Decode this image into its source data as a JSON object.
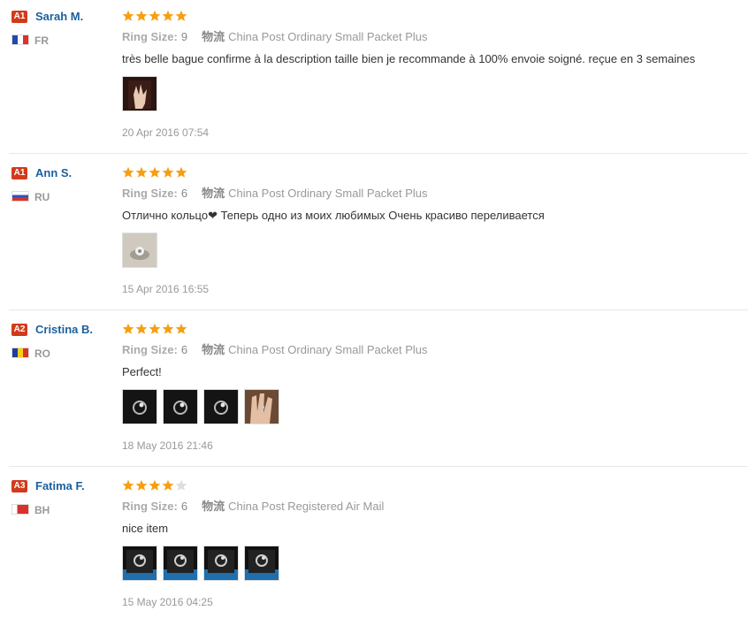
{
  "reviews": [
    {
      "badge": "A1",
      "name": "Sarah M.",
      "country": "FR",
      "flag": [
        "#1f4aa8",
        "#ffffff",
        "#e0302c"
      ],
      "rating": 5,
      "ring_size_label": "Ring Size:",
      "ring_size": "9",
      "shipping_label": "物流",
      "shipping": "China Post Ordinary Small Packet Plus",
      "text": "très belle bague confirme à la description taille bien je recommande à 100% envoie soigné. reçue en 3 semaines",
      "photos": [
        "photo-hand"
      ],
      "date": "20 Apr 2016 07:54"
    },
    {
      "badge": "A1",
      "name": "Ann S.",
      "country": "RU",
      "flag": [
        "#ffffff",
        "#2a56b8",
        "#d8322c"
      ],
      "rating": 5,
      "ring_size_label": "Ring Size:",
      "ring_size": "6",
      "shipping_label": "物流",
      "shipping": "China Post Ordinary Small Packet Plus",
      "text": "Отлично кольцо❤ Теперь одно из моих любимых Очень красиво переливается",
      "photos": [
        "photo-ring-light"
      ],
      "date": "15 Apr 2016 16:55"
    },
    {
      "badge": "A2",
      "name": "Cristina B.",
      "country": "RO",
      "flag": [
        "#1f3f9c",
        "#f5d216",
        "#d8322c"
      ],
      "rating": 5,
      "ring_size_label": "Ring Size:",
      "ring_size": "6",
      "shipping_label": "物流",
      "shipping": "China Post Ordinary Small Packet Plus",
      "text": "Perfect!",
      "photos": [
        "photo-ring-dark",
        "photo-ring-dark",
        "photo-ring-dark",
        "photo-hand-ring"
      ],
      "date": "18 May 2016 21:46"
    },
    {
      "badge": "A3",
      "name": "Fatima F.",
      "country": "BH",
      "flag": [
        "#ffffff",
        "#d8322c",
        "#d8322c"
      ],
      "rating": 4,
      "ring_size_label": "Ring Size:",
      "ring_size": "6",
      "shipping_label": "物流",
      "shipping": "China Post Registered Air Mail",
      "text": "nice item",
      "photos": [
        "photo-box-ring",
        "photo-box-ring",
        "photo-box-ring",
        "photo-box-ring"
      ],
      "date": "15 May 2016 04:25"
    }
  ],
  "colors": {
    "star_on": "#f5a011",
    "star_off": "#dddddd",
    "badge": "#d33a1b",
    "name": "#1b5f9e"
  }
}
